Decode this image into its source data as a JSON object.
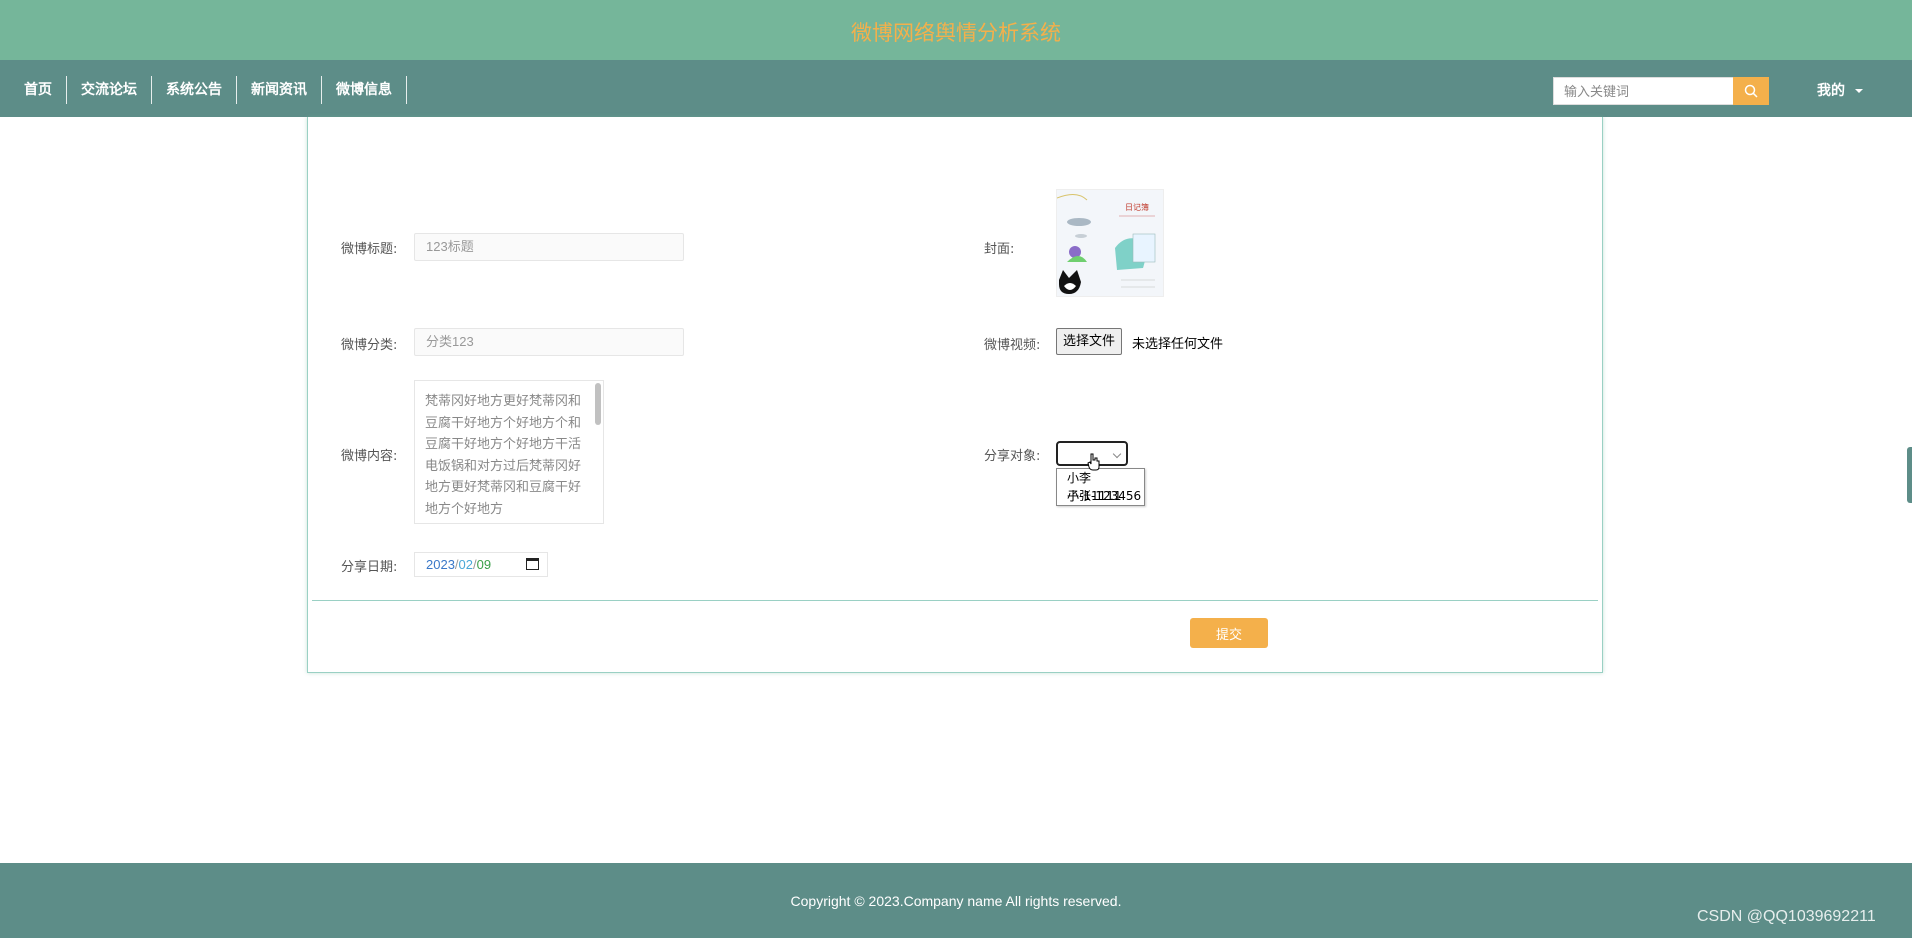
{
  "header": {
    "site_title": "微博网络舆情分析系统"
  },
  "nav": {
    "items": [
      {
        "label": "首页"
      },
      {
        "label": "交流论坛"
      },
      {
        "label": "系统公告"
      },
      {
        "label": "新闻资讯"
      },
      {
        "label": "微博信息"
      }
    ],
    "search_placeholder": "输入关键词",
    "user_menu_label": "我的"
  },
  "form": {
    "title_label": "微博标题:",
    "title_value": "123标题",
    "category_label": "微博分类:",
    "category_value": "分类123",
    "content_label": "微博内容:",
    "content_value": "梵蒂冈好地方更好梵蒂冈和豆腐干好地方个好地方个和豆腐干好地方个好地方干活电饭锅和对方过后梵蒂冈好地方更好梵蒂冈和豆腐干好地方个好地方",
    "date_label": "分享日期:",
    "date_year": "2023",
    "date_month": "02",
    "date_day": "09",
    "date_sep": "/",
    "cover_label": "封面:",
    "cover_image_text": "日记簿",
    "video_label": "微博视频:",
    "file_button_label": "选择文件",
    "file_status": "未选择任何文件",
    "share_target_label": "分享对象:",
    "share_options": [
      "小李子-11111",
      "小张-123456"
    ],
    "submit_label": "提交"
  },
  "footer": {
    "copyright": "Copyright © 2023.Company name All rights reserved.",
    "watermark": "CSDN @QQ1039692211"
  },
  "colors": {
    "header_bg": "#75b69a",
    "nav_bg": "#5d8d88",
    "accent": "#f4b04b",
    "panel_border": "#9ad0c4"
  }
}
